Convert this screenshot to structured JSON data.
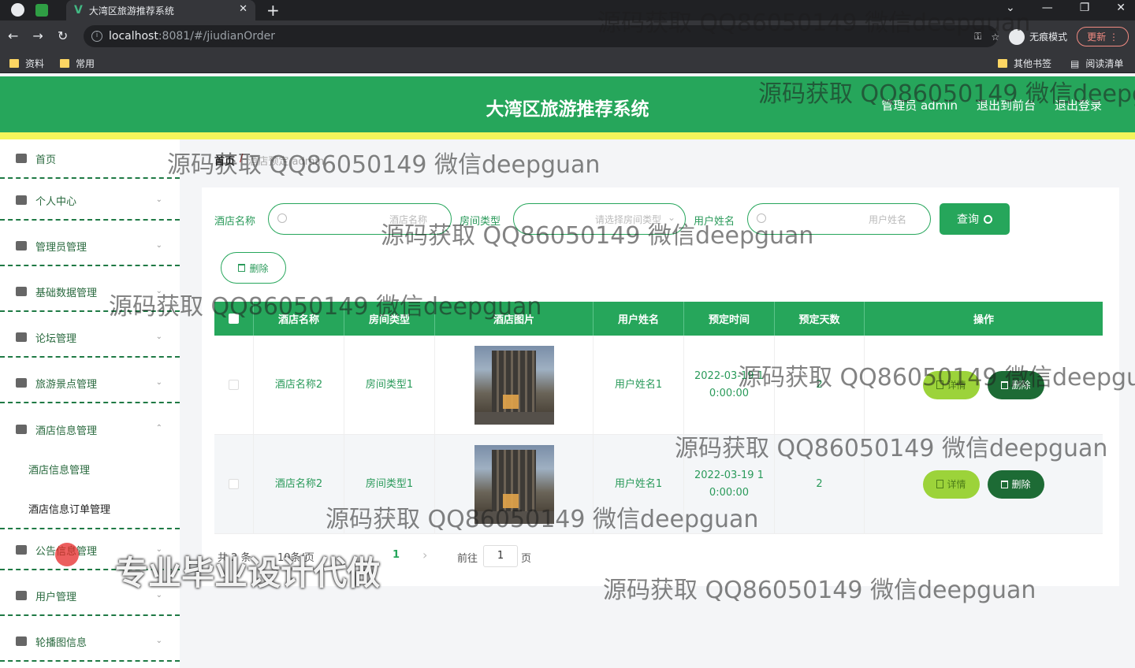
{
  "browser": {
    "tab_title": "大湾区旅游推荐系统",
    "tab_close": "✕",
    "new_tab": "+",
    "url_host": "localhost",
    "url_path": ":8081/#/jiudianOrder",
    "incognito_label": "无痕模式",
    "update_label": "更新",
    "window_controls": [
      "⌄",
      "—",
      "❐",
      "✕"
    ],
    "bookmarks": [
      "资料",
      "常用"
    ],
    "other_bookmarks": "其他书签",
    "reading_list": "阅读清单"
  },
  "header": {
    "title": "大湾区旅游推荐系统",
    "admin_label": "管理员 admin",
    "to_front": "退出到前台",
    "logout": "退出登录"
  },
  "sidebar": {
    "items": [
      {
        "label": "首页",
        "icon": "home-icon"
      },
      {
        "label": "个人中心",
        "icon": "user-icon"
      },
      {
        "label": "管理员管理",
        "icon": "card-icon"
      },
      {
        "label": "基础数据管理",
        "icon": "sliders-icon"
      },
      {
        "label": "论坛管理",
        "icon": "compass-icon"
      },
      {
        "label": "旅游景点管理",
        "icon": "list-icon"
      },
      {
        "label": "酒店信息管理",
        "icon": "grid-icon"
      },
      {
        "label": "公告信息管理",
        "icon": "chart-icon"
      },
      {
        "label": "用户管理",
        "icon": "user-icon"
      },
      {
        "label": "轮播图信息",
        "icon": "briefcase-icon"
      }
    ],
    "sub_items": [
      "酒店信息管理",
      "酒店信息订单管理"
    ]
  },
  "breadcrumb": {
    "home": "首页",
    "current": "酒店预定 admin"
  },
  "filters": {
    "hotel_label": "酒店名称",
    "hotel_placeholder": "酒店名称",
    "room_label": "房间类型",
    "room_placeholder": "请选择房间类型",
    "user_label": "用户姓名",
    "user_placeholder": "用户姓名",
    "query_button": "查询",
    "delete_button": "删除"
  },
  "table": {
    "headers": [
      "酒店名称",
      "房间类型",
      "酒店图片",
      "用户姓名",
      "预定时间",
      "预定天数",
      "操作"
    ],
    "rows": [
      {
        "hotel": "酒店名称2",
        "room": "房间类型1",
        "user": "用户姓名1",
        "time": "2022-03-19 1\n0:00:00",
        "days": "2"
      },
      {
        "hotel": "酒店名称2",
        "room": "房间类型1",
        "user": "用户姓名1",
        "time": "2022-03-19 1\n0:00:00",
        "days": "2"
      }
    ],
    "detail_label": "详情",
    "delete_label": "删除"
  },
  "pagination": {
    "total": "共 2 条",
    "page_size": "10条/页",
    "page": "1",
    "goto_prefix": "前往",
    "goto_value": "1",
    "goto_suffix": "页"
  },
  "watermarks": {
    "qq": "源码获取 QQ86050149 微信deepguan",
    "big": "专业毕业设计代做"
  },
  "colors": {
    "primary": "#26a65b",
    "accent_strip": "#f3f55b",
    "detail_btn": "#9cd33a",
    "delete_btn": "#1d6b35"
  }
}
